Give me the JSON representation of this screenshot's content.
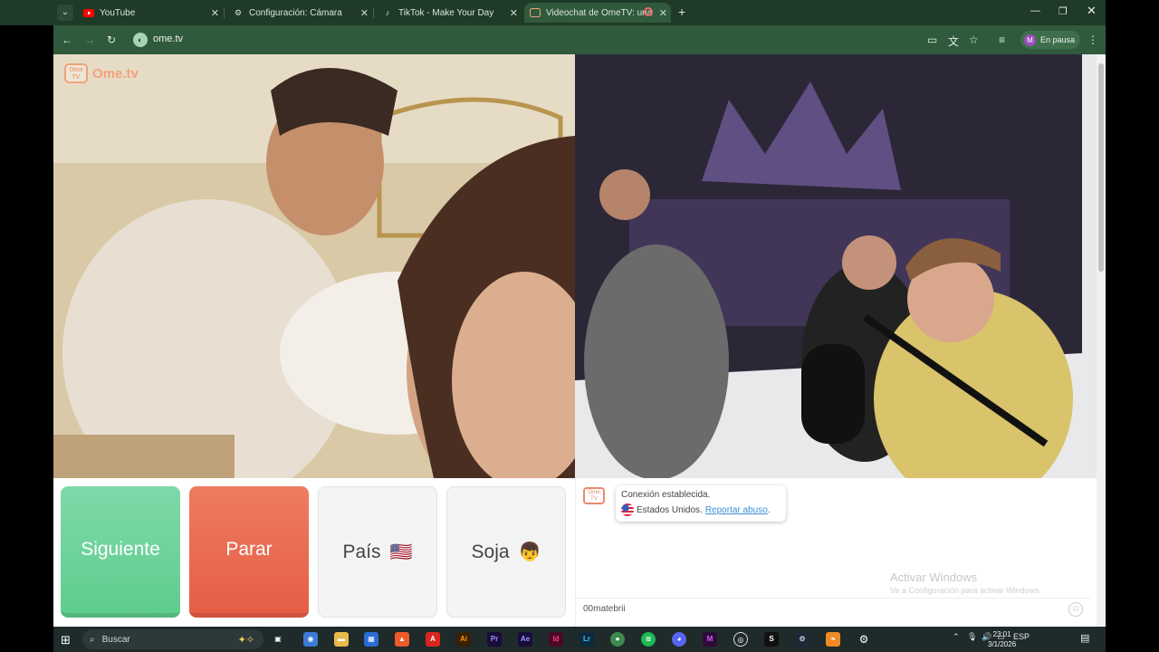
{
  "browser": {
    "tabs": [
      {
        "title": "YouTube",
        "icon": "youtube-icon",
        "icon_color": "#ff0000"
      },
      {
        "title": "Configuración: Cámara",
        "icon": "gear-icon",
        "icon_color": "#dbe6dd"
      },
      {
        "title": "TikTok - Make Your Day",
        "icon": "tiktok-icon",
        "icon_color": "#ffffff"
      },
      {
        "title": "Videochat de OmeTV: una",
        "icon": "ometv-icon",
        "icon_color": "#f1a27b",
        "active": true
      }
    ],
    "url": "ome.tv",
    "profile_initial": "M",
    "profile_status": "En pausa"
  },
  "app": {
    "logo_text": "Ome.tv",
    "logo_badge": "Ome TV",
    "buttons": {
      "next_label": "Siguiente",
      "stop_label": "Parar",
      "country_label": "País",
      "country_emoji": "🇺🇸",
      "gender_label": "Soja",
      "gender_emoji": "👦"
    },
    "chat": {
      "status": "Conexión establecida.",
      "country": "Estados Unidos",
      "separator": " .",
      "report_link": "Reportar abuso",
      "report_suffix": ".",
      "input_value": "00matebrii",
      "watermark_title": "Activar Windows",
      "watermark_sub": "Ve a Configuración para activar Windows."
    }
  },
  "taskbar": {
    "search_placeholder": "Buscar",
    "language": "ESP",
    "time": "23:01",
    "date": "3/1/2026"
  },
  "colors": {
    "next": "#6ad39a",
    "stop": "#e8684e",
    "accent": "#f1a27b",
    "chrome": "#2f5a3c"
  }
}
